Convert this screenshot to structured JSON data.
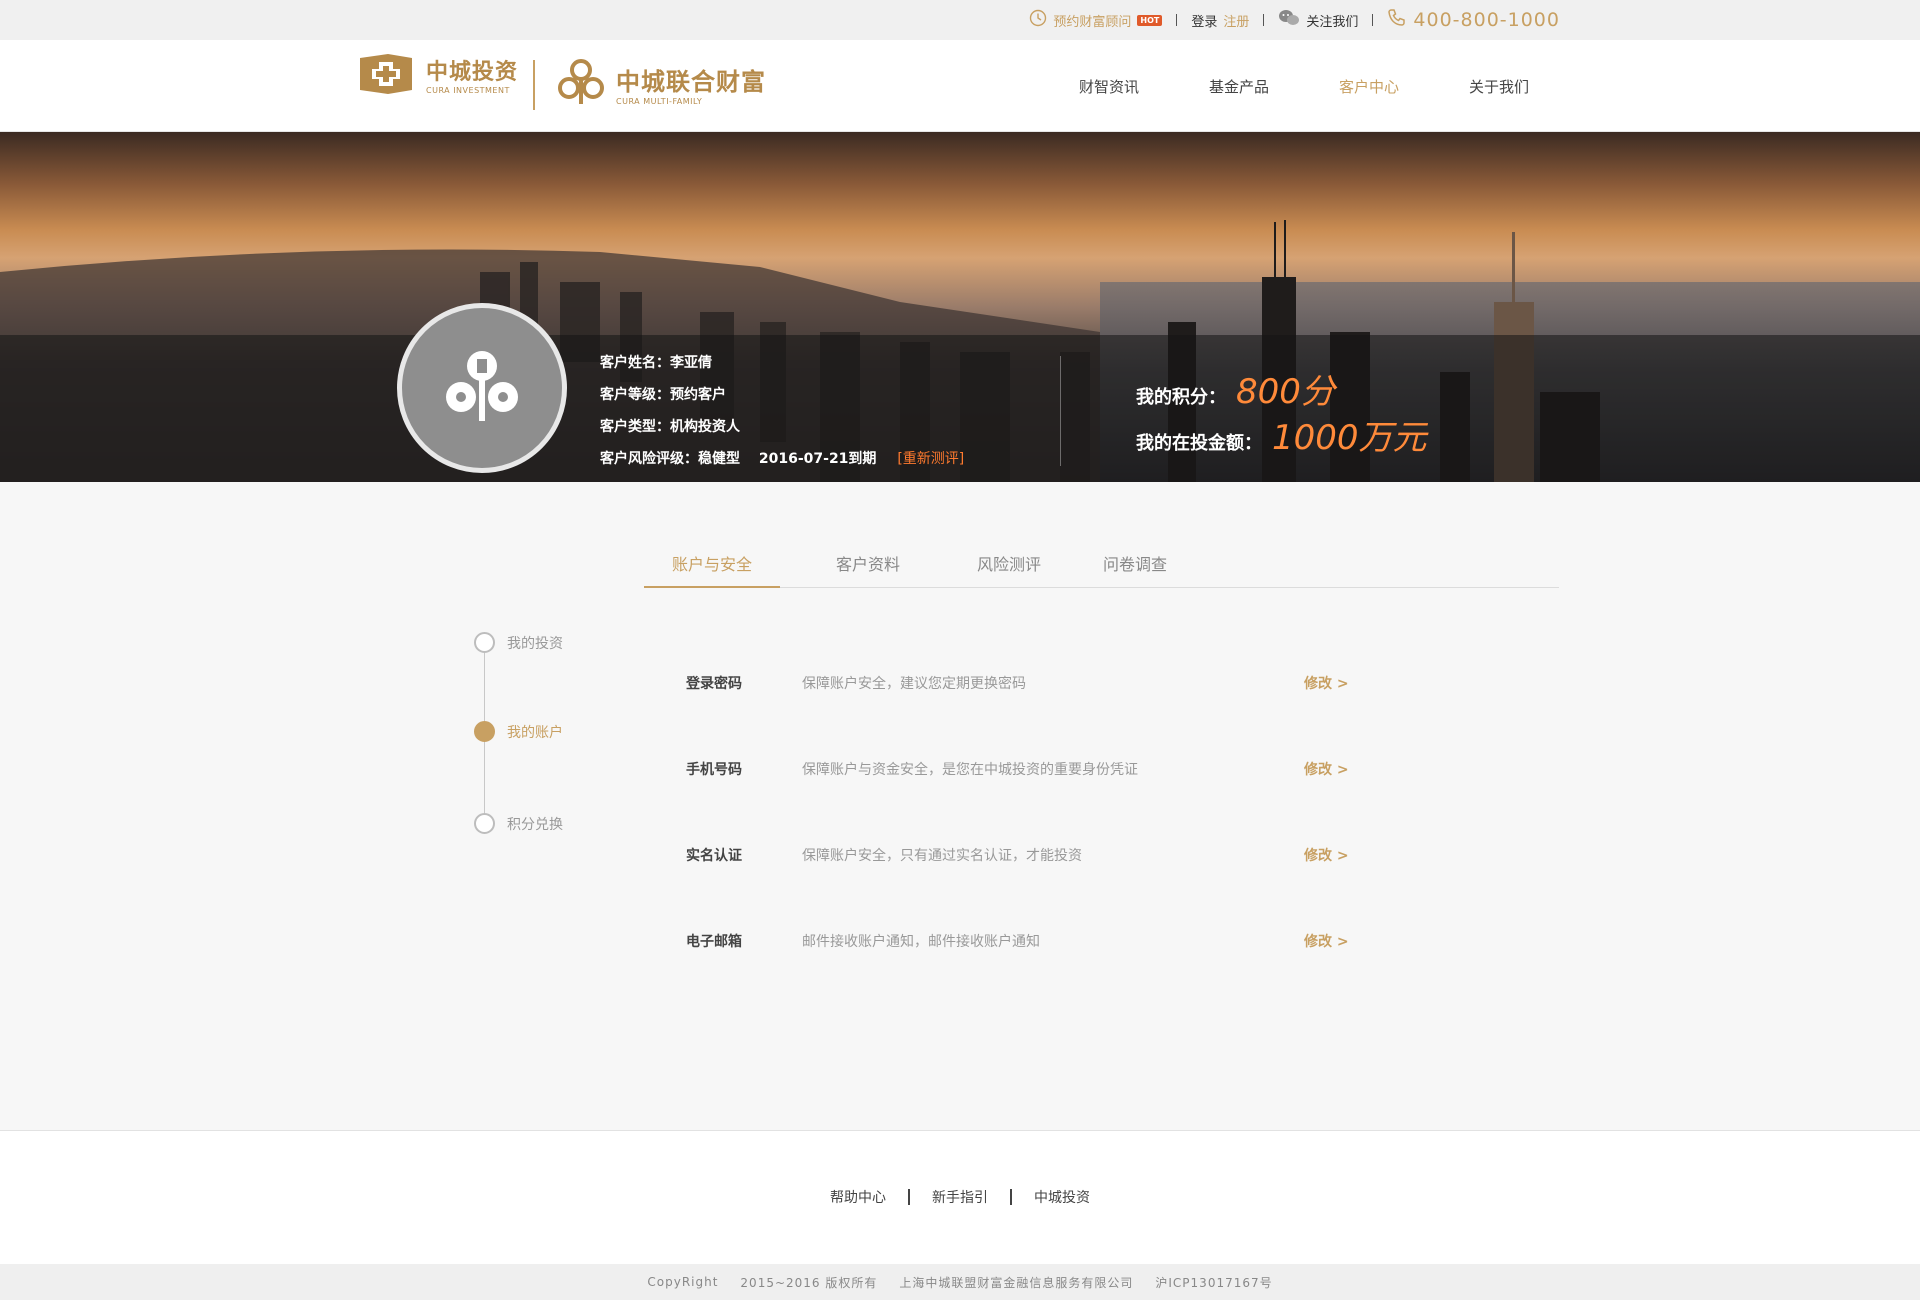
{
  "topbar": {
    "appointment": "预约财富顾问",
    "hot_badge": "HOT",
    "login": "登录",
    "register": "注册",
    "follow": "关注我们",
    "phone": "400-800-1000"
  },
  "header": {
    "logo1_cn": "中城投资",
    "logo1_en": "CURA INVESTMENT",
    "logo2_cn": "中城联合财富",
    "logo2_en": "CURA MULTI-FAMILY",
    "nav": [
      "财智资讯",
      "基金产品",
      "客户中心",
      "关于我们"
    ],
    "active_nav": "客户中心"
  },
  "profile": {
    "name_row": "客户姓名：李亚倩",
    "level_row": "客户等级：预约客户",
    "type_row": "客户类型：机构投资人",
    "risk_row": "客户风险评级：稳健型　 2016-07-21到期",
    "retest": "[重新测评]",
    "points_label": "我的积分：",
    "points_value": "800分",
    "invest_label": "我的在投金额：",
    "invest_value": "1000万元"
  },
  "tabs": [
    "账户与安全",
    "客户资料",
    "风险测评",
    "问卷调查"
  ],
  "side_steps": [
    "我的投资",
    "我的账户",
    "积分兑换"
  ],
  "security": [
    {
      "label": "登录密码",
      "desc": "保障账户安全，建议您定期更换密码",
      "edit": "修改 >"
    },
    {
      "label": "手机号码",
      "desc": "保障账户与资金安全，是您在中城投资的重要身份凭证",
      "edit": "修改 >"
    },
    {
      "label": "实名认证",
      "desc": "保障账户安全，只有通过实名认证，才能投资",
      "edit": "修改 >"
    },
    {
      "label": "电子邮箱",
      "desc": "邮件接收账户通知，邮件接收账户通知",
      "edit": "修改 >"
    }
  ],
  "footer": {
    "links": [
      "帮助中心",
      "新手指引",
      "中城投资"
    ],
    "copyright": "CopyRight",
    "years": "2015~2016 版权所有",
    "company": "上海中城联盟财富金融信息服务有限公司",
    "icp": "沪ICP13017167号"
  },
  "colors": {
    "accent": "#c8a062",
    "highlight": "#ff8a3a",
    "topbar_bg": "#f0f0f0"
  }
}
